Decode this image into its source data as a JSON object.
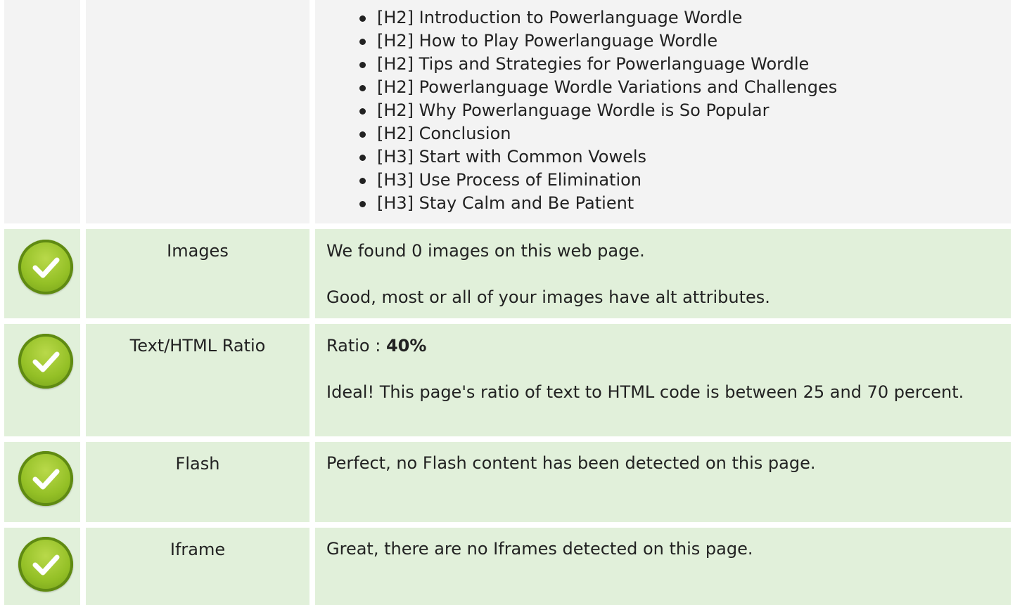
{
  "headings": [
    "[H2] Introduction to Powerlanguage Wordle",
    "[H2] How to Play Powerlanguage Wordle",
    "[H2] Tips and Strategies for Powerlanguage Wordle",
    "[H2] Powerlanguage Wordle Variations and Challenges",
    "[H2] Why Powerlanguage Wordle is So Popular",
    "[H2] Conclusion",
    "[H3] Start with Common Vowels",
    "[H3] Use Process of Elimination",
    "[H3] Stay Calm and Be Patient"
  ],
  "checks": {
    "images": {
      "status_icon": "check-circle-icon",
      "label": "Images",
      "line1": "We found 0 images on this web page.",
      "line2": "Good, most or all of your images have alt attributes."
    },
    "text_html_ratio": {
      "status_icon": "check-circle-icon",
      "label": "Text/HTML Ratio",
      "ratio_prefix": "Ratio : ",
      "ratio_value": "40%",
      "line2": "Ideal! This page's ratio of text to HTML code is between 25 and 70 percent."
    },
    "flash": {
      "status_icon": "check-circle-icon",
      "label": "Flash",
      "line1": "Perfect, no Flash content has been detected on this page."
    },
    "iframe": {
      "status_icon": "check-circle-icon",
      "label": "Iframe",
      "line1": "Great, there are no Iframes detected on this page."
    }
  },
  "colors": {
    "good_row_bg": "#e1f0da",
    "neutral_row_bg": "#f3f3f3",
    "check_green": "#94c026"
  }
}
